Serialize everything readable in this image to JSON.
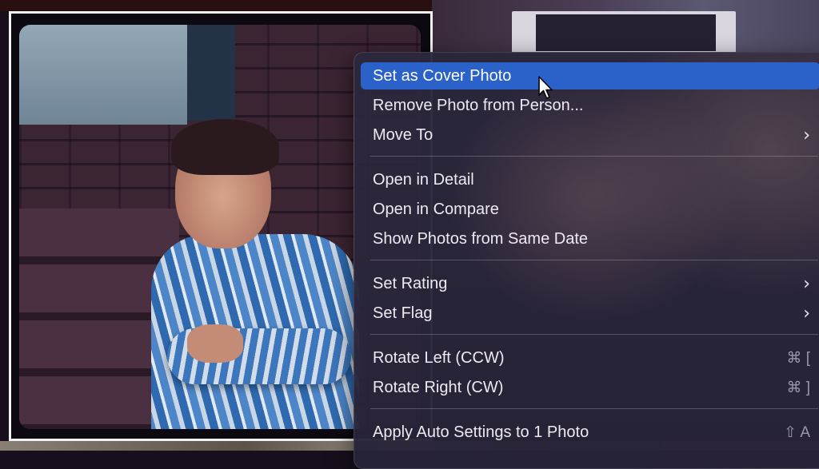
{
  "menu": {
    "items": [
      {
        "label": "Set as Cover Photo",
        "highlight": true
      },
      {
        "label": "Remove Photo from Person..."
      },
      {
        "label": "Move To",
        "submenu": true
      },
      {
        "label": "Open in Detail"
      },
      {
        "label": "Open in Compare"
      },
      {
        "label": "Show Photos from Same Date"
      },
      {
        "label": "Set Rating",
        "submenu": true
      },
      {
        "label": "Set Flag",
        "submenu": true
      },
      {
        "label": "Rotate Left (CCW)",
        "shortcut": "⌘ ["
      },
      {
        "label": "Rotate Right (CW)",
        "shortcut": "⌘ ]"
      },
      {
        "label": "Apply Auto Settings to 1 Photo",
        "shortcut": "⇧ A"
      }
    ],
    "submenu_glyph": "›",
    "highlight_color": "#2a62c9"
  },
  "icons": {
    "cursor": "arrow-cursor-icon",
    "submenu": "chevron-right-icon"
  }
}
